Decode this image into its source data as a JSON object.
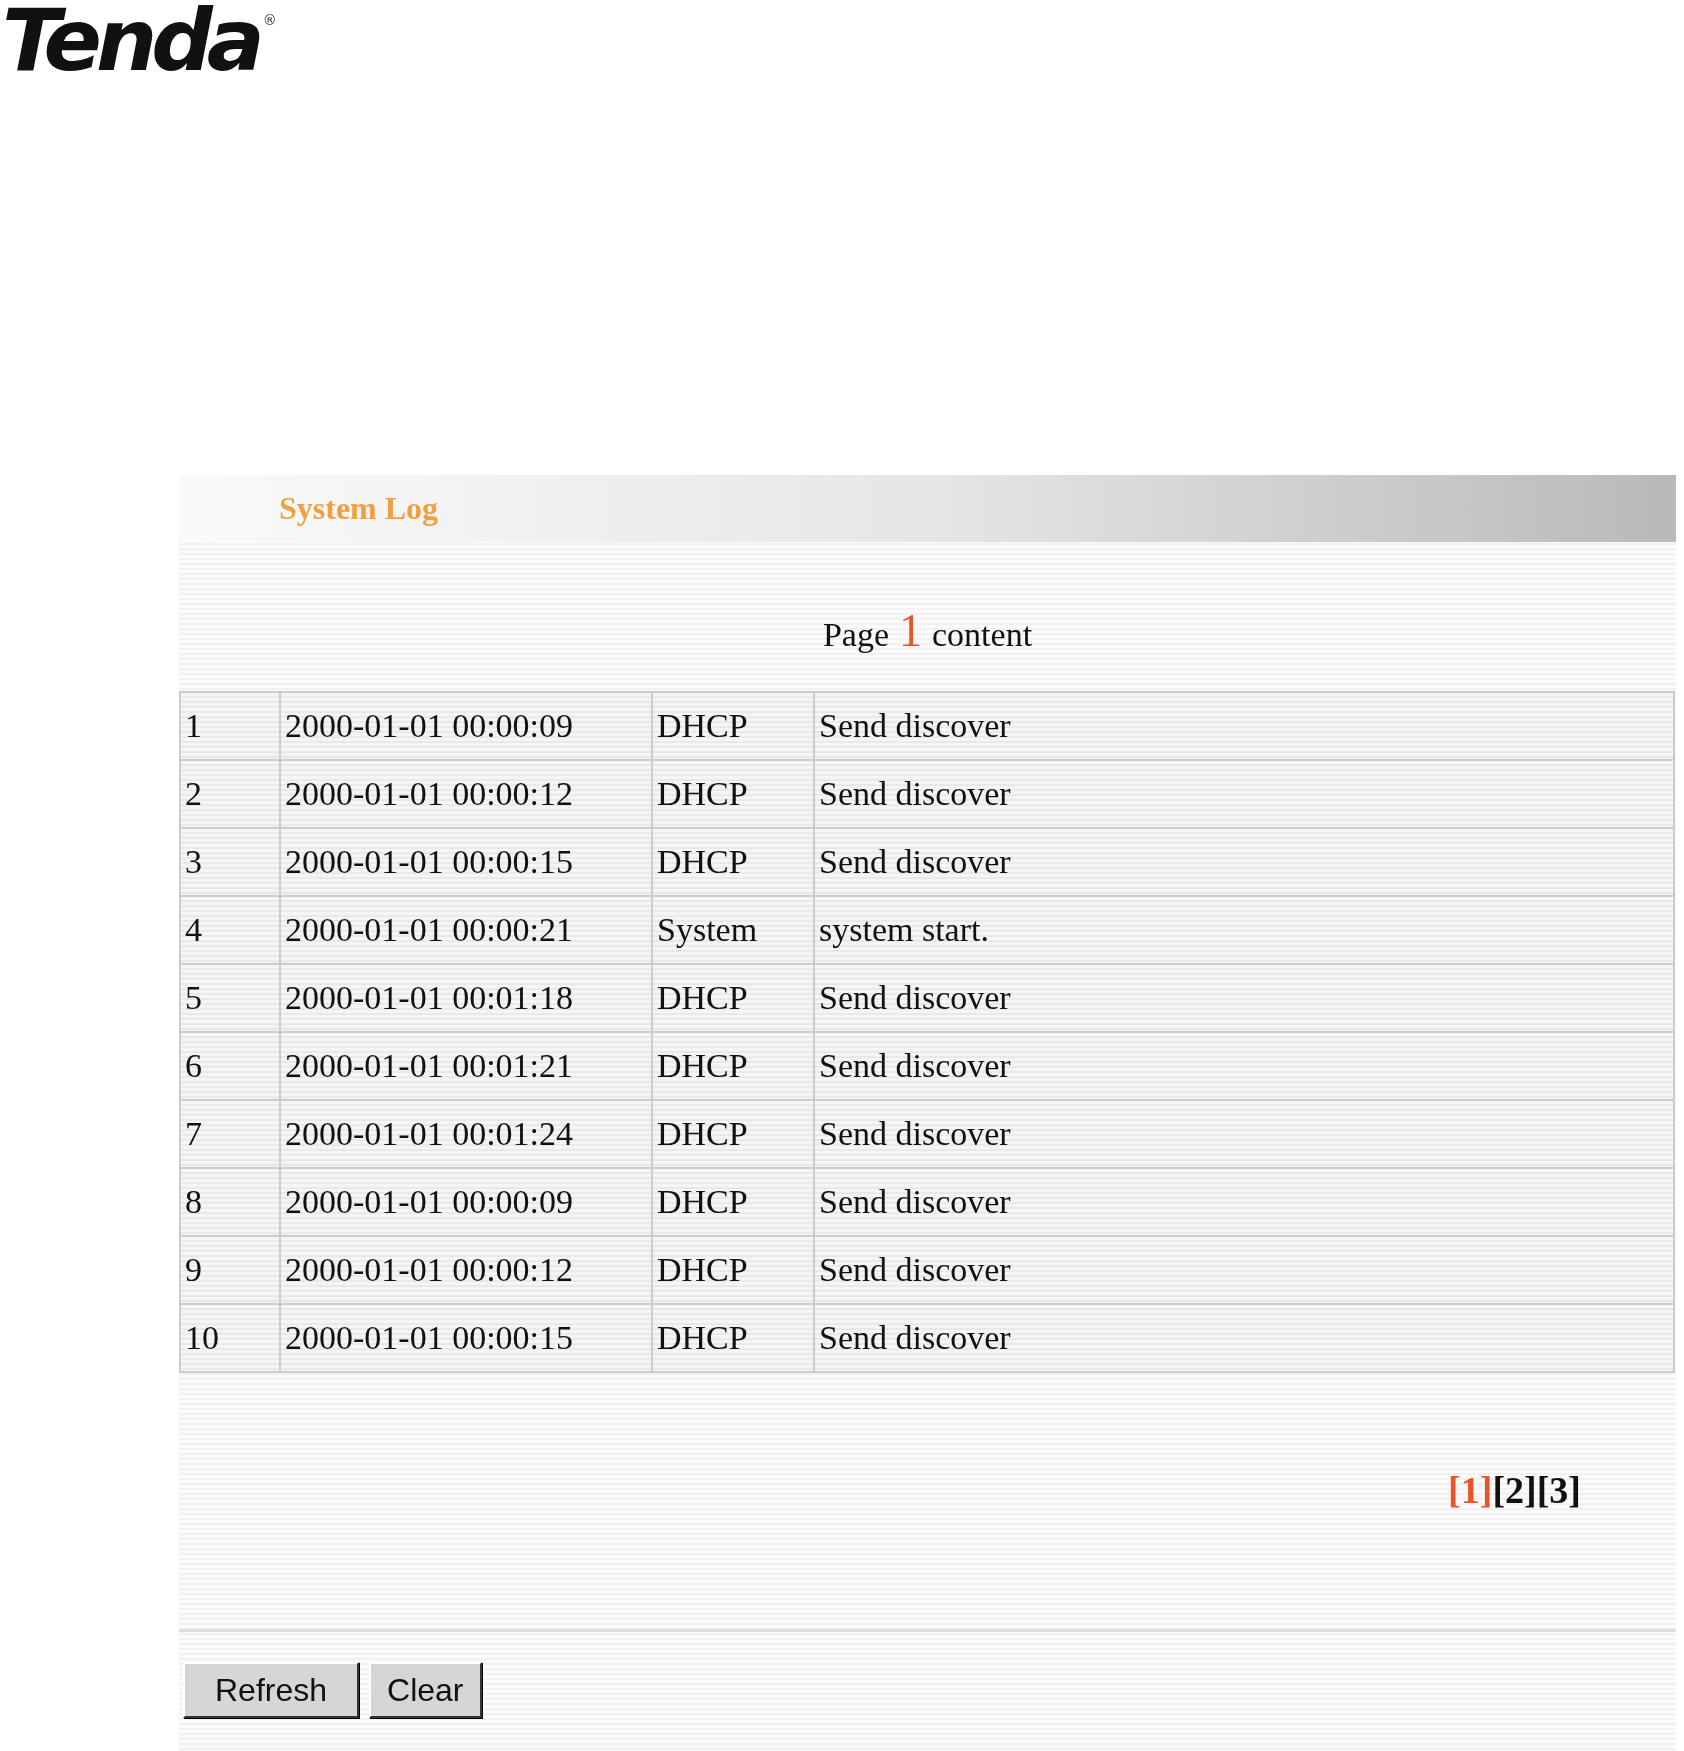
{
  "logo": {
    "text": "Tenda",
    "mark": "®"
  },
  "panel": {
    "title": "System Log"
  },
  "page_caption": {
    "prefix": "Page",
    "current": "1",
    "suffix": "content"
  },
  "log_rows": [
    {
      "index": "1",
      "time": "2000-01-01 00:00:09",
      "type": "DHCP",
      "message": "Send discover"
    },
    {
      "index": "2",
      "time": "2000-01-01 00:00:12",
      "type": "DHCP",
      "message": "Send discover"
    },
    {
      "index": "3",
      "time": "2000-01-01 00:00:15",
      "type": "DHCP",
      "message": "Send discover"
    },
    {
      "index": "4",
      "time": "2000-01-01 00:00:21",
      "type": "System",
      "message": "system start."
    },
    {
      "index": "5",
      "time": "2000-01-01 00:01:18",
      "type": "DHCP",
      "message": "Send discover"
    },
    {
      "index": "6",
      "time": "2000-01-01 00:01:21",
      "type": "DHCP",
      "message": "Send discover"
    },
    {
      "index": "7",
      "time": "2000-01-01 00:01:24",
      "type": "DHCP",
      "message": "Send discover"
    },
    {
      "index": "8",
      "time": "2000-01-01 00:00:09",
      "type": "DHCP",
      "message": "Send discover"
    },
    {
      "index": "9",
      "time": "2000-01-01 00:00:12",
      "type": "DHCP",
      "message": "Send discover"
    },
    {
      "index": "10",
      "time": "2000-01-01 00:00:15",
      "type": "DHCP",
      "message": "Send discover"
    }
  ],
  "pages": [
    {
      "label": "[1]",
      "selected": true
    },
    {
      "label": "[2]",
      "selected": false
    },
    {
      "label": "[3]",
      "selected": false
    }
  ],
  "buttons": [
    "Refresh",
    "Clear"
  ]
}
